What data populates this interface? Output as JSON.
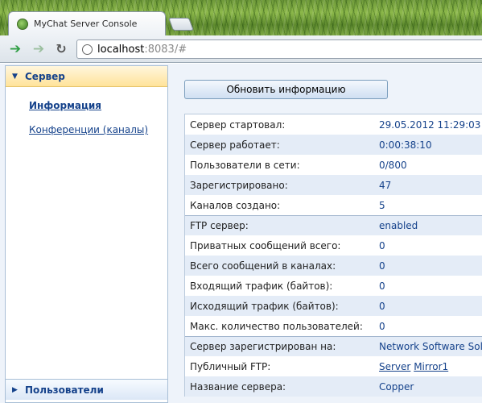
{
  "browser": {
    "tabs": [
      {
        "title": "MyChat Server Console",
        "active": true
      }
    ],
    "address": {
      "host": "localhost",
      "rest": ":8083/#"
    }
  },
  "sidebar": {
    "sections": [
      {
        "title": "Сервер",
        "expanded": true
      },
      {
        "title": "Пользователи",
        "expanded": false
      }
    ],
    "links": {
      "info": "Информация",
      "conferences": "Конференции (каналы)"
    }
  },
  "main": {
    "refresh_label": "Обновить информацию",
    "rows": [
      {
        "label": "Сервер стартовал:",
        "value": "29.05.2012 11:29:03"
      },
      {
        "label": "Сервер работает:",
        "value": "0:00:38:10"
      },
      {
        "label": "Пользователи в сети:",
        "value": "0/800"
      },
      {
        "label": "Зарегистрировано:",
        "value": "47"
      },
      {
        "label": "Каналов создано:",
        "value": "5"
      },
      {
        "label": "FTP сервер:",
        "value": "enabled"
      },
      {
        "label": "Приватных сообщений всего:",
        "value": "0"
      },
      {
        "label": "Всего сообщений в каналах:",
        "value": "0"
      },
      {
        "label": "Входящий трафик (байтов):",
        "value": "0"
      },
      {
        "label": "Исходящий трафик (байтов):",
        "value": "0"
      },
      {
        "label": "Макс. количество пользователей:",
        "value": "0"
      },
      {
        "label": "Сервер зарегистрирован на:",
        "value": "Network Software Solutions"
      },
      {
        "label": "Публичный FTP:",
        "links": [
          "Server",
          "Mirror1"
        ]
      },
      {
        "label": "Название сервера:",
        "value": "Copper"
      }
    ]
  }
}
